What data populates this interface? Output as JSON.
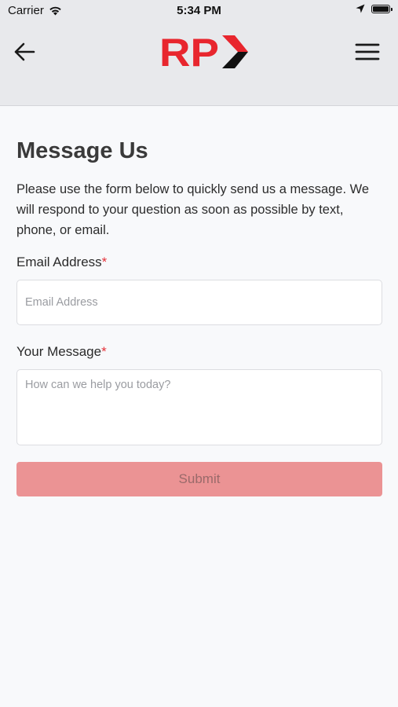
{
  "status_bar": {
    "carrier": "Carrier",
    "time": "5:34 PM",
    "battery_level": 1.0,
    "icons": [
      "wifi-icon",
      "location-arrow-icon",
      "battery-icon"
    ]
  },
  "header": {
    "back_icon": "arrow-left-icon",
    "logo_text": "RP",
    "menu_icon": "hamburger-menu-icon"
  },
  "page": {
    "title": "Message Us",
    "intro": "Please use the form below to quickly send us a message. We will respond to your question as soon as possible by text, phone, or email."
  },
  "form": {
    "email_label": "Email Address",
    "email_required_marker": "*",
    "email_value": "",
    "email_placeholder": "Email Address",
    "message_label": "Your Message",
    "message_required_marker": "*",
    "message_value": "",
    "message_placeholder": "How can we help you today?",
    "submit_label": "Submit"
  },
  "colors": {
    "brand_red": "#e8262e",
    "brand_black": "#111111",
    "header_background": "#e8e9ec",
    "page_background": "#f8f9fb",
    "required_red": "#e5323a",
    "submit_disabled": "#eb9394"
  }
}
